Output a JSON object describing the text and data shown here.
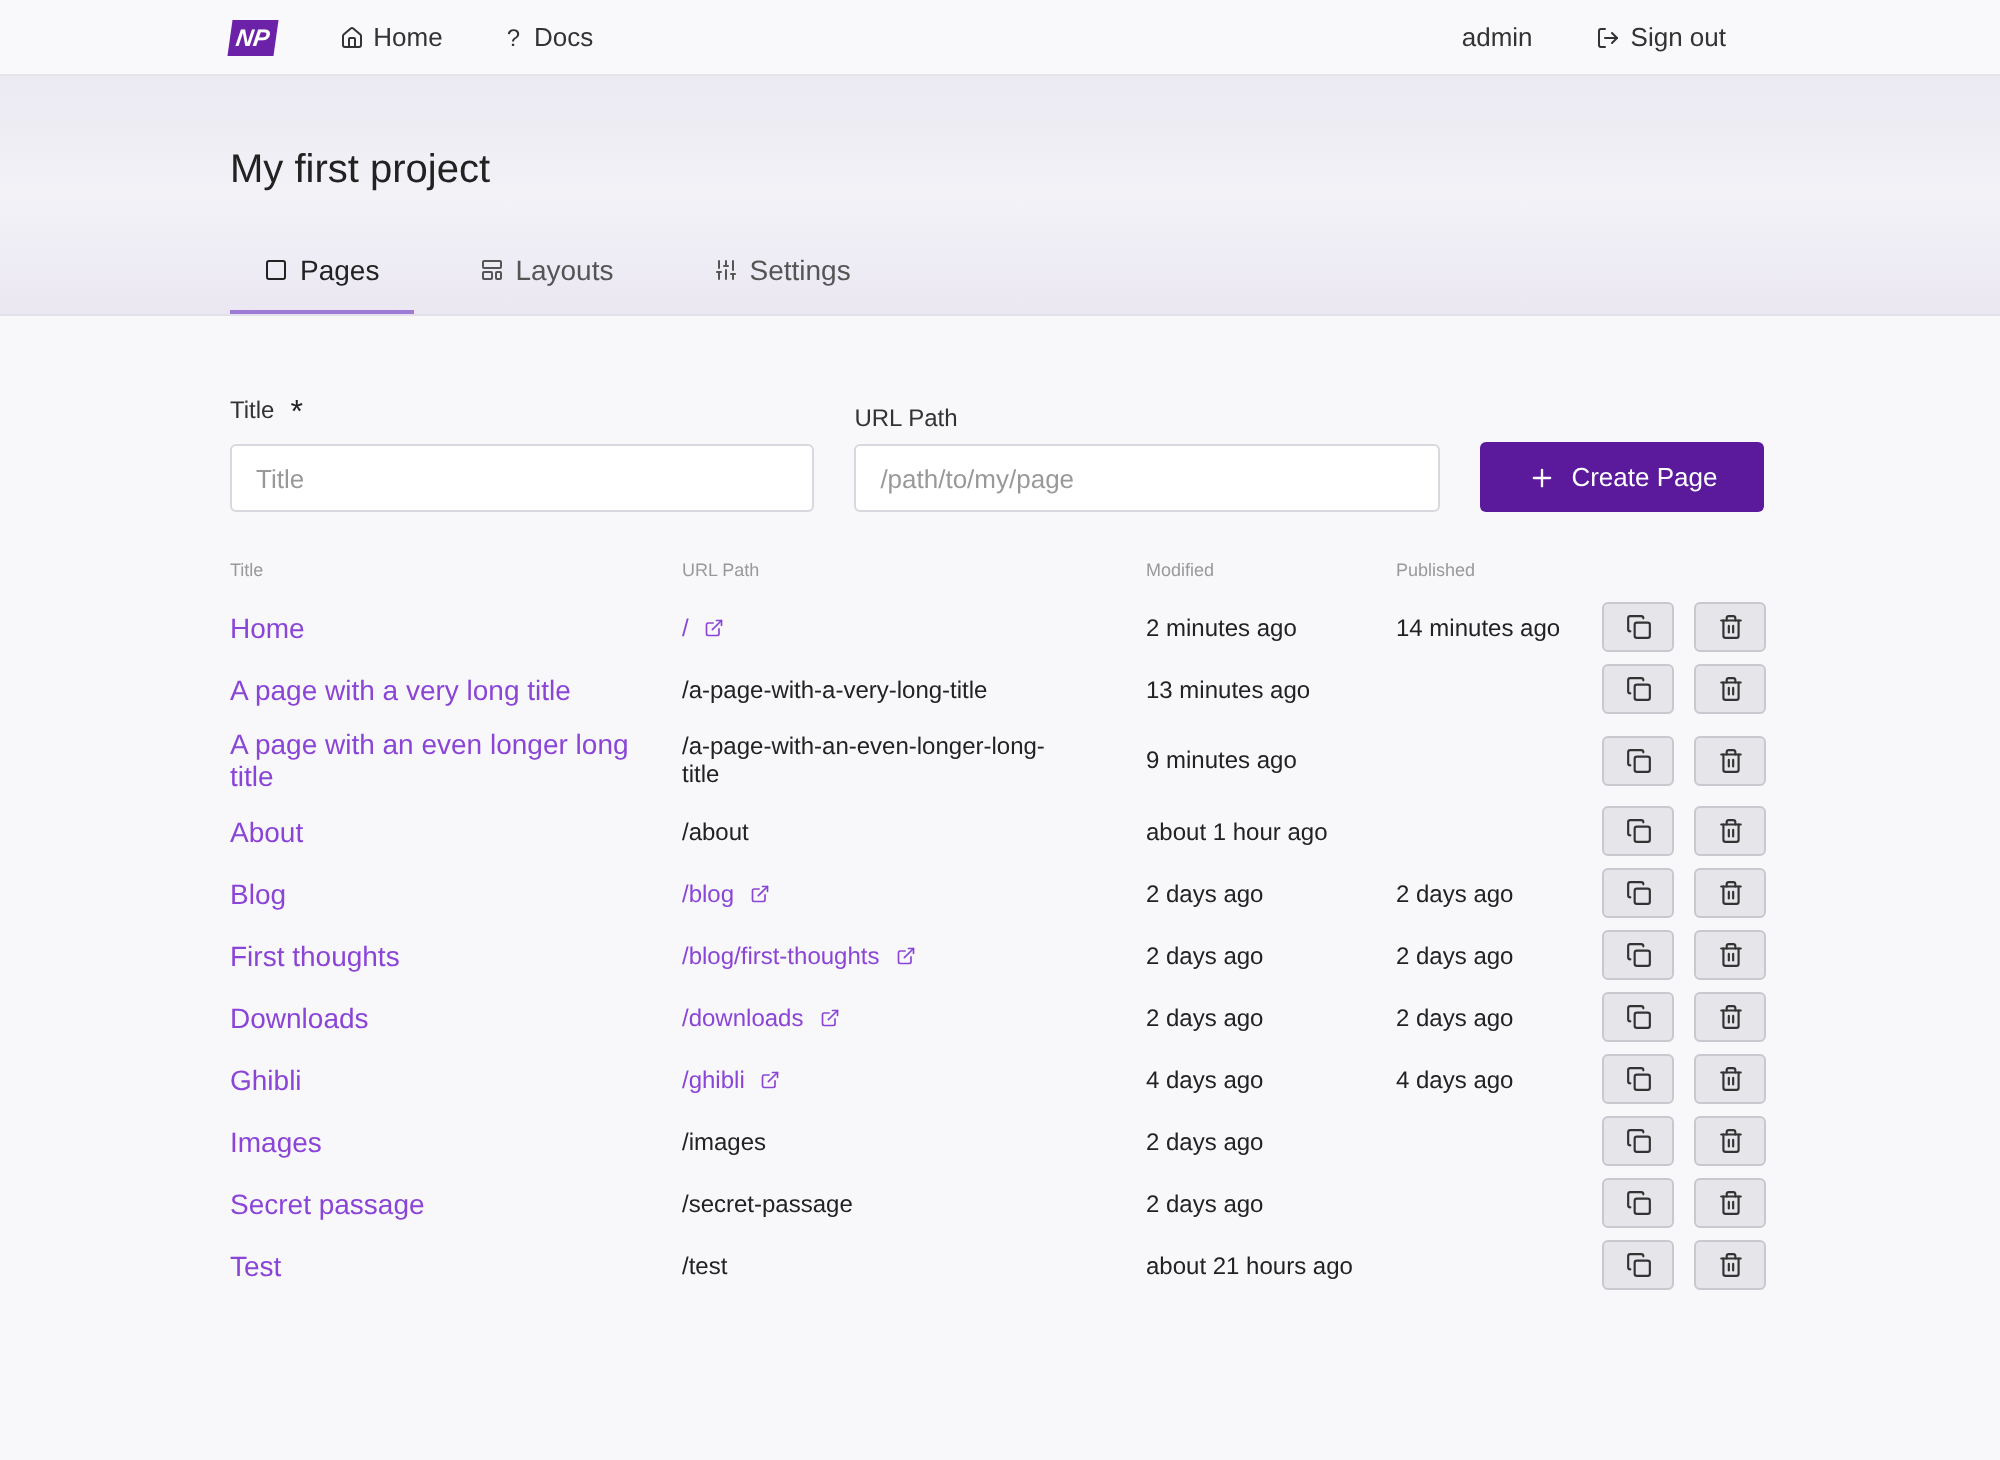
{
  "nav": {
    "logo": "NP",
    "links": [
      {
        "label": "Home"
      },
      {
        "label": "Docs",
        "glyph": "?"
      }
    ],
    "user": "admin",
    "sign_out": "Sign out"
  },
  "project": {
    "title": "My first project"
  },
  "tabs": [
    {
      "label": "Pages",
      "selected": true
    },
    {
      "label": "Layouts",
      "selected": false
    },
    {
      "label": "Settings",
      "selected": false
    }
  ],
  "form": {
    "title_label": "Title",
    "required_mark": "*",
    "title_placeholder": "Title",
    "url_label": "URL Path",
    "url_placeholder": "/path/to/my/page",
    "submit": "Create Page"
  },
  "table": {
    "columns": [
      "Title",
      "URL Path",
      "Modified",
      "Published"
    ],
    "rows": [
      {
        "title": "Home",
        "url": "/",
        "linked": true,
        "modified": "2 minutes ago",
        "published": "14 minutes ago"
      },
      {
        "title": "A page with a very long title",
        "url": "/a-page-with-a-very-long-title",
        "linked": false,
        "modified": "13 minutes ago"
      },
      {
        "title": "A page with an even longer long title",
        "url": "/a-page-with-an-even-longer-long-title",
        "linked": false,
        "modified": "9 minutes ago"
      },
      {
        "title": "About",
        "url": "/about",
        "linked": false,
        "modified": "about 1 hour ago"
      },
      {
        "title": "Blog",
        "url": "/blog",
        "linked": true,
        "modified": "2 days ago",
        "published": "2 days ago"
      },
      {
        "title": "First thoughts",
        "url": "/blog/first-thoughts",
        "linked": true,
        "modified": "2 days ago",
        "published": "2 days ago"
      },
      {
        "title": "Downloads",
        "url": "/downloads",
        "linked": true,
        "modified": "2 days ago",
        "published": "2 days ago"
      },
      {
        "title": "Ghibli",
        "url": "/ghibli",
        "linked": true,
        "modified": "4 days ago",
        "published": "4 days ago"
      },
      {
        "title": "Images",
        "url": "/images",
        "linked": false,
        "modified": "2 days ago"
      },
      {
        "title": "Secret passage",
        "url": "/secret-passage",
        "linked": false,
        "modified": "2 days ago"
      },
      {
        "title": "Test",
        "url": "/test",
        "linked": false,
        "modified": "about 21 hours ago"
      }
    ]
  }
}
